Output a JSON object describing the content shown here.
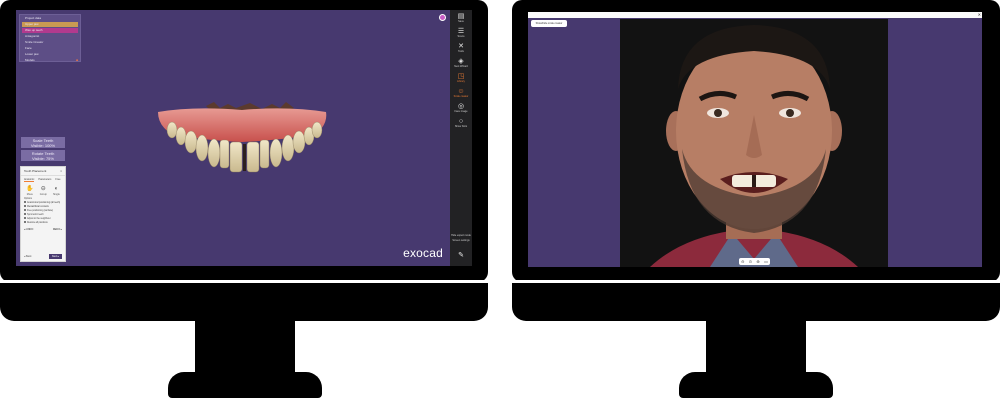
{
  "left_app": {
    "brand_logo": "exocad",
    "tree_items": [
      {
        "label": "Project data",
        "tag": ""
      },
      {
        "label": "Upper jaw",
        "tag": ""
      },
      {
        "label": "Wax up teeth",
        "tag": ""
      },
      {
        "label": "Antagonist",
        "tag": ""
      },
      {
        "label": "Smile Creator",
        "tag": ""
      },
      {
        "label": "Face",
        "tag": ""
      },
      {
        "label": "Lower jaw",
        "tag": ""
      },
      {
        "label": "Models",
        "tag": "■"
      }
    ],
    "toolbar": [
      {
        "icon": "save-icon",
        "glyph": "▤",
        "label": "Save"
      },
      {
        "icon": "layers-icon",
        "glyph": "☰",
        "label": "Scans"
      },
      {
        "icon": "tools-icon",
        "glyph": "✕",
        "label": "Tools"
      },
      {
        "icon": "wizard-icon",
        "glyph": "◈",
        "label": "Next Wizard"
      },
      {
        "icon": "tooth-library-icon",
        "glyph": "◳",
        "label": "Library",
        "active": true
      },
      {
        "icon": "smile-icon",
        "glyph": "☺",
        "label": "Smile creator",
        "active": true
      },
      {
        "icon": "camera-icon",
        "glyph": "◎",
        "label": "Face image"
      },
      {
        "icon": "help-icon",
        "glyph": "○",
        "label": "Show hints"
      }
    ],
    "toolbar_bottom": [
      "Hide expert mode",
      "Screen settings"
    ],
    "side_buttons": [
      {
        "line1": "Scale Teeth",
        "line2": "Visible: 100%"
      },
      {
        "line1": "Rotate Teeth",
        "line2": "Visible: 75%"
      }
    ],
    "wizard": {
      "title": "Tooth Placement",
      "tabs": [
        "Anatomic",
        "Parameters",
        "Free"
      ],
      "tools": [
        {
          "icon": "pointer-icon",
          "glyph": "✋",
          "label": "Move"
        },
        {
          "icon": "group-icon",
          "glyph": "⊖",
          "label": "Group"
        },
        {
          "icon": "single-icon",
          "glyph": "◐",
          "label": "Single"
        }
      ],
      "options_label": "Options",
      "options": [
        "Anatomical positioning (all teeth)",
        "Mesial/distal contacts",
        "Free positioning (surface)",
        "Symmetric teeth",
        "Adjust to the neighbour",
        "Restore all positions"
      ],
      "nav_left": "◂ UNDO",
      "nav_right": "REDO ▸",
      "back_label": "◂ Back",
      "next_label": "Next ▸"
    }
  },
  "right_app": {
    "pill_button_label": "Show/hide smile creator",
    "close_glyph": "✕",
    "zoom_controls": [
      "⊖",
      "⊙",
      "⊕",
      "▭"
    ]
  },
  "colors": {
    "workspace": "#47396f",
    "accent": "#ef7d36",
    "toolbar": "#222224",
    "monitor": "#000000"
  }
}
